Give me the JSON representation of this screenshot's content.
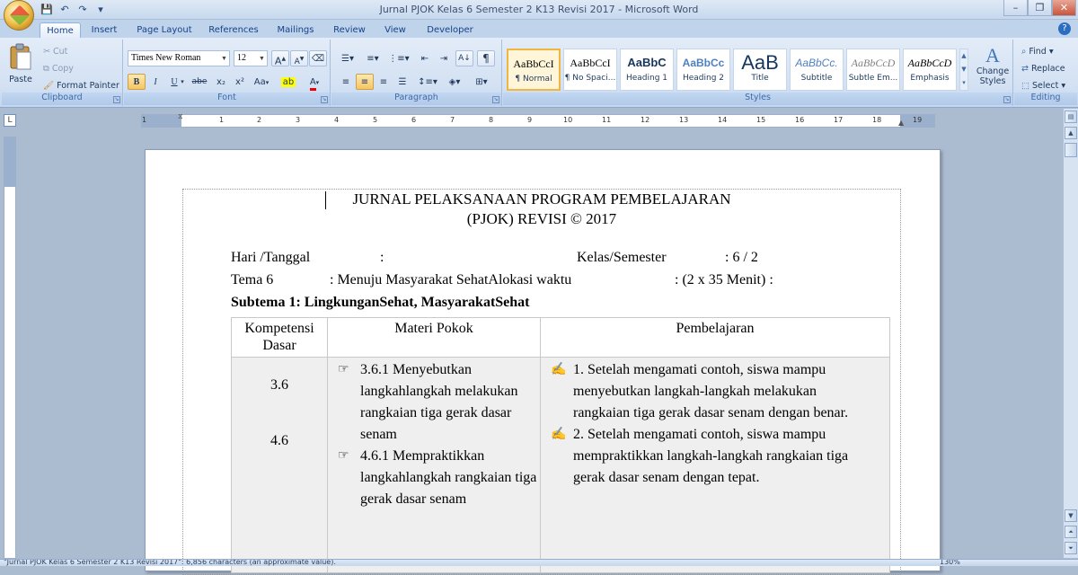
{
  "window": {
    "title": "Jurnal PJOK Kelas 6 Semester 2 K13 Revisi 2017 - Microsoft Word",
    "controls": {
      "minimize": "–",
      "maximize": "❐",
      "close": "✕"
    }
  },
  "qat": {
    "save": "💾",
    "undo": "↶",
    "redo": "↷",
    "more": "▾"
  },
  "tabs": [
    {
      "label": "Home",
      "active": true
    },
    {
      "label": "Insert"
    },
    {
      "label": "Page Layout"
    },
    {
      "label": "References"
    },
    {
      "label": "Mailings"
    },
    {
      "label": "Review"
    },
    {
      "label": "View"
    },
    {
      "label": "Developer"
    }
  ],
  "ribbon": {
    "clipboard": {
      "label": "Clipboard",
      "paste": "Paste",
      "cut": "Cut",
      "copy": "Copy",
      "format_painter": "Format Painter"
    },
    "font": {
      "label": "Font",
      "name": "Times New Roman",
      "size": "12",
      "bold": "B",
      "italic": "I",
      "underline": "U",
      "strike": "abe",
      "subscript": "x₂",
      "superscript": "x²",
      "change_case": "Aa",
      "grow": "A",
      "shrink": "A"
    },
    "paragraph": {
      "label": "Paragraph"
    },
    "styles": {
      "label": "Styles",
      "items": [
        {
          "sample": "AaBbCcI",
          "name": "¶ Normal",
          "selected": true
        },
        {
          "sample": "AaBbCcI",
          "name": "¶ No Spaci..."
        },
        {
          "sample": "AaBbC",
          "name": "Heading 1"
        },
        {
          "sample": "AaBbCc",
          "name": "Heading 2"
        },
        {
          "sample": "AaB",
          "name": "Title"
        },
        {
          "sample": "AaBbCc.",
          "name": "Subtitle"
        },
        {
          "sample": "AaBbCcD",
          "name": "Subtle Em..."
        },
        {
          "sample": "AaBbCcD",
          "name": "Emphasis"
        }
      ],
      "change_styles": "Change Styles"
    },
    "editing": {
      "label": "Editing",
      "find": "Find",
      "replace": "Replace",
      "select": "Select"
    }
  },
  "ruler": {
    "numbers": [
      "1",
      "1",
      "2",
      "3",
      "4",
      "5",
      "6",
      "7",
      "8",
      "9",
      "10",
      "11",
      "12",
      "13",
      "14",
      "15",
      "16",
      "17",
      "18",
      "19"
    ]
  },
  "document": {
    "title_line1": "JURNAL PELAKSANAAN PROGRAM PEMBELAJARAN",
    "title_line2": "(PJOK) REVISI © 2017",
    "hari_label": "Hari /Tanggal",
    "hari_colon": ":",
    "kelas_label": "Kelas/Semester",
    "kelas_value": ":  6 / 2",
    "tema_label": "Tema 6",
    "tema_value": ":  Menuju Masyarakat SehatAlokasi waktu",
    "alokasi_value": ": (2  x 35 Menit) :",
    "subtema": "Subtema 1: LingkunganSehat, MasyarakatSehat",
    "table": {
      "headers": [
        "Kompetensi Dasar",
        "Materi Pokok",
        "Pembelajaran"
      ],
      "kd": [
        "3.6",
        "4.6"
      ],
      "materi": [
        "3.6.1 Menyebutkan langkahlangkah melakukan rangkaian tiga gerak dasar senam",
        "4.6.1 Mempraktikkan langkahlangkah rangkaian tiga gerak dasar senam"
      ],
      "pembelajaran": [
        "1. Setelah mengamati contoh, siswa mampu menyebutkan langkah-langkah melakukan rangkaian tiga gerak dasar senam dengan benar.",
        "2. Setelah mengamati contoh, siswa mampu mempraktikkan langkah-langkah rangkaian tiga gerak dasar senam dengan tepat."
      ],
      "materi_bullet": "☞",
      "pembelajaran_bullet": "✍"
    }
  },
  "statusbar": {
    "text": "\"Jurnal PJOK Kelas 6 Semester 2 K13 Revisi 2017\": 6,856 characters (an approximate value).",
    "zoom": "130%"
  }
}
